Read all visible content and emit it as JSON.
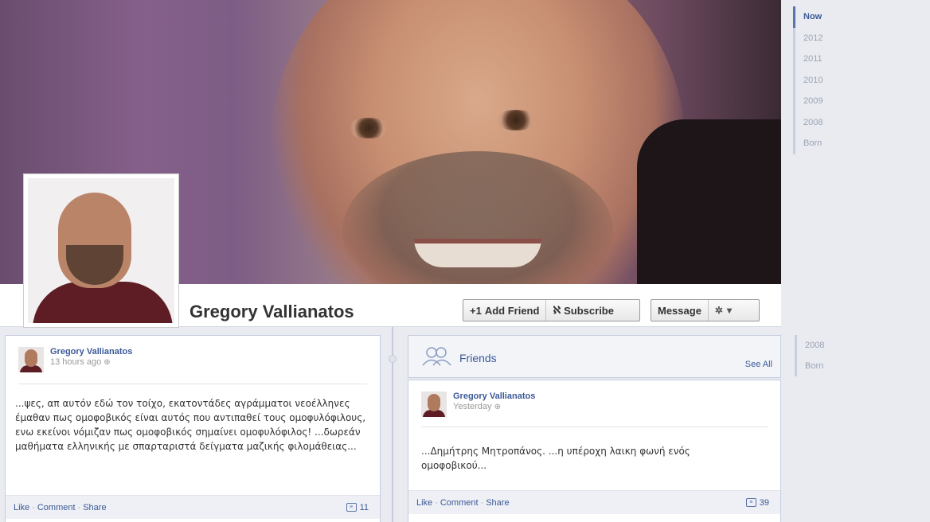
{
  "profile": {
    "name": "Gregory Vallianatos"
  },
  "actions": {
    "add_friend": "Add Friend",
    "subscribe": "Subscribe",
    "message": "Message",
    "settings_caret": "▾"
  },
  "timeline_nav": {
    "items": [
      "Now",
      "2012",
      "2011",
      "2010",
      "2009",
      "2008",
      "Born"
    ]
  },
  "timeline_nav_secondary": {
    "items": [
      "2008",
      "Born"
    ]
  },
  "posts": [
    {
      "author": "Gregory Vallianatos",
      "time": "13 hours ago",
      "text": "...ψες, απ αυτόν εδώ τον τοίχο, εκατοντάδες αγράμματοι νεοέλληνες έμαθαν πως ομοφοβικός είναι αυτός που αντιπαθεί τους ομοφυλόφιλους, ενω εκείνοι νόμιζαν πως ομοφοβικός σημαίνει ομοφυλόφιλος! ...δωρεάν μαθήματα ελληνικής με σπαρταριστά δείγματα μαζικής φιλομάθειας...",
      "like": "Like",
      "comment": "Comment",
      "share": "Share",
      "comment_count": "11"
    },
    {
      "author": "Gregory Vallianatos",
      "time": "Yesterday",
      "text": "...Δημήτρης Μητροπάνος. ...η υπέροχη λαικη φωνή ενός ομοφοβικού...",
      "like": "Like",
      "comment": "Comment",
      "share": "Share",
      "comment_count": "39"
    }
  ],
  "friends_box": {
    "title": "Friends",
    "see_all": "See All"
  },
  "colors": {
    "link": "#3b5998",
    "background": "#e9ebf0"
  }
}
